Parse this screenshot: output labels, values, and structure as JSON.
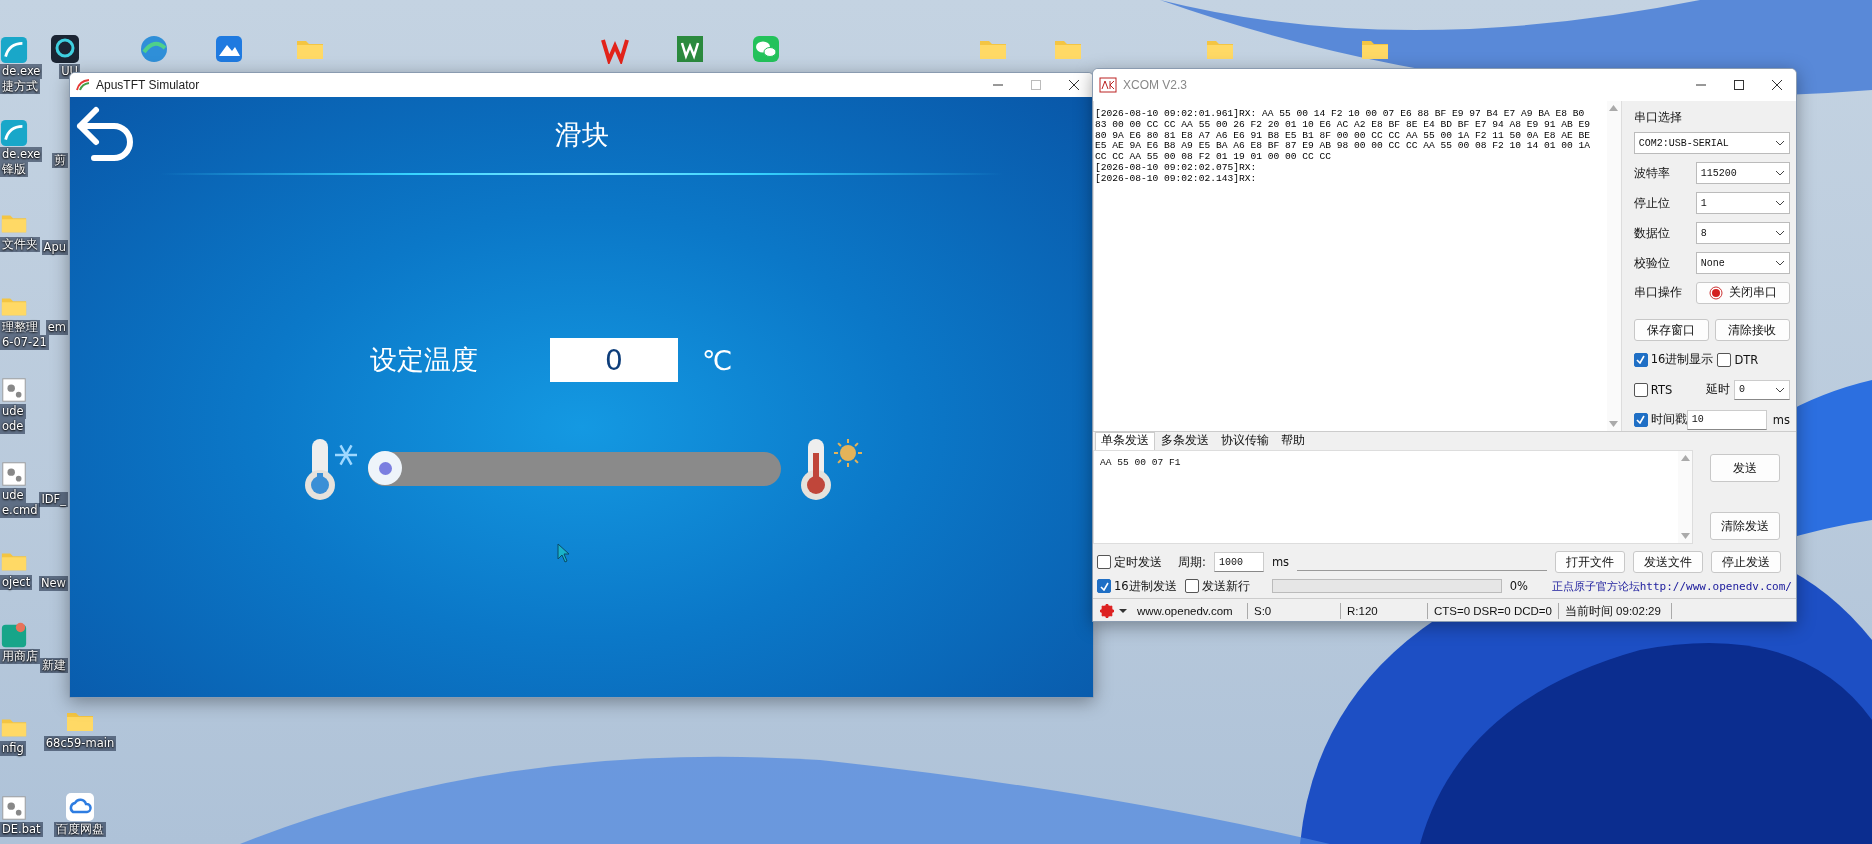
{
  "desktop": {
    "top_row": [
      {
        "kind": "edge"
      },
      {
        "kind": "share"
      },
      {
        "kind": "folder"
      },
      {
        "kind": "wps"
      },
      {
        "kind": "word"
      },
      {
        "kind": "wechat"
      },
      {
        "kind": "folder"
      },
      {
        "kind": "folder"
      },
      {
        "kind": "folder"
      },
      {
        "kind": "folder"
      }
    ],
    "left_column": [
      {
        "kind": "app-teal",
        "lines": [
          "de.exe",
          "捷方式"
        ]
      },
      {
        "kind": "app-teal",
        "lines": [
          "de.exe",
          "锋版"
        ]
      },
      {
        "kind": "folder",
        "lines": [
          "文件夹"
        ]
      },
      {
        "kind": "folder",
        "lines": [
          "理整理",
          "6-07-21"
        ]
      },
      {
        "kind": "gear",
        "lines": [
          "ude",
          "ode"
        ]
      },
      {
        "kind": "gear",
        "lines": [
          "ude",
          "e.cmd"
        ]
      },
      {
        "kind": "folder",
        "lines": [
          "oject"
        ]
      },
      {
        "kind": "store",
        "lines": [
          "用商店"
        ]
      },
      {
        "kind": "folder",
        "lines": [
          "nfig"
        ]
      },
      {
        "kind": "gear",
        "lines": [
          "DE.bat"
        ]
      }
    ],
    "second_column": [
      {
        "kind": "app-dark",
        "lines": [
          "UU"
        ]
      },
      {
        "lines": [
          "剪"
        ]
      },
      {
        "lines": [
          "Apu"
        ]
      },
      {
        "lines": [
          "em"
        ]
      },
      {
        "lines": [
          "IDF_"
        ]
      },
      {
        "lines": [
          "New"
        ]
      },
      {
        "lines": [
          "新建"
        ]
      },
      {
        "kind": "folder",
        "lines": [
          "68c59-main"
        ]
      },
      {
        "kind": "cloud",
        "lines": [
          "百度网盘"
        ]
      }
    ]
  },
  "simulator": {
    "title": "ApusTFT Simulator",
    "heading": "滑块",
    "setting": {
      "label": "设定温度",
      "value": "0",
      "unit": "℃"
    },
    "slider": {
      "level": 0
    }
  },
  "xcom": {
    "title": "XCOM V2.3",
    "receive_log": [
      "[2026-08-10 09:02:01.961]RX: AA 55 00 14 F2 10 00 07 E6 88 BF E9 97 B4 E7 A9 BA E8 B0",
      "83 00 00 CC CC AA 55 00 26 F2 20 01 10 E6 AC A2 E8 BF 8E E4 BD BF E7 94 A8 E9 91 AB E9",
      "80 9A E6 80 81 E8 A7 A6 E6 91 B8 E5 B1 8F 00 00 CC CC AA 55 00 1A F2 11 50 0A E8 AE BE",
      "E5 AE 9A E6 B8 A9 E5 BA A6 E8 BF 87 E9 AB 98 00 00 CC CC AA 55 00 08 F2 10 14 01 00 1A",
      "CC CC AA 55 00 08 F2 01 19 01 00 00 CC CC",
      "[2026-08-10 09:02:02.075]RX:",
      "[2026-08-10 09:02:02.143]RX:"
    ],
    "port_label": "串口选择",
    "port": "COM2:USB-SERIAL",
    "fields": [
      {
        "label": "波特率",
        "value": "115200"
      },
      {
        "label": "停止位",
        "value": "1"
      },
      {
        "label": "数据位",
        "value": "8"
      },
      {
        "label": "校验位",
        "value": "None"
      }
    ],
    "port_operation": {
      "label": "串口操作",
      "button": "关闭串口",
      "open": true
    },
    "buttons": [
      "保存窗口",
      "清除接收"
    ],
    "hex_display": {
      "label": "16进制显示",
      "checked": true
    },
    "dtr": {
      "label": "DTR",
      "checked": false
    },
    "rts": {
      "label": "RTS",
      "checked": false
    },
    "delay": {
      "label": "延时",
      "value": "0"
    },
    "timestamp": {
      "label": "时间戳",
      "checked": true,
      "value": "10",
      "unit": "ms"
    },
    "tabs": [
      {
        "label": "单条发送",
        "selected": true
      },
      {
        "label": "多条发送",
        "selected": false
      },
      {
        "label": "协议传输",
        "selected": false
      },
      {
        "label": "帮助",
        "selected": false
      }
    ],
    "send_text": "AA 55 00 07 F1",
    "send_buttons": [
      "发送",
      "清除发送"
    ],
    "timed_send": {
      "label": "定时发送",
      "checked": false
    },
    "period": {
      "label": "周期:",
      "value": "1000",
      "unit": "ms"
    },
    "file_buttons": [
      "打开文件",
      "发送文件",
      "停止发送"
    ],
    "hex_send": {
      "label": "16进制发送",
      "checked": true
    },
    "send_newline": {
      "label": "发送新行",
      "checked": false
    },
    "progress": {
      "level": 0,
      "reading": "0%"
    },
    "forum_link": "正点原子官方论坛http://www.openedv.com/",
    "status_bar": [
      "www.openedv.com",
      "S:0",
      "R:120",
      "CTS=0 DSR=0 DCD=0",
      "当前时间 09:02:29"
    ]
  }
}
